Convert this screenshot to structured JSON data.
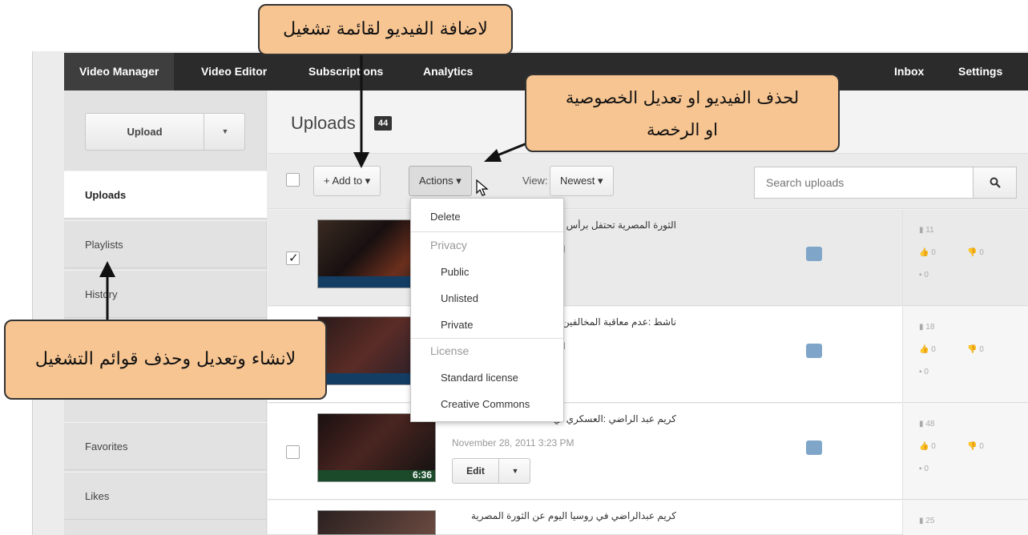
{
  "topbar": {
    "items": [
      "Video Manager",
      "Video Editor",
      "Subscriptions",
      "Analytics",
      "Inbox",
      "Settings"
    ]
  },
  "sidebar": {
    "upload_label": "Upload",
    "items": [
      "Uploads",
      "Playlists",
      "History",
      "Favorites",
      "Likes"
    ]
  },
  "main": {
    "title": "Uploads",
    "count": "44",
    "toolbar": {
      "add_to": "+ Add to ▾",
      "actions": "Actions ▾",
      "view_label": "View:",
      "view_value": "Newest ▾",
      "search_placeholder": "Search uploads"
    }
  },
  "actions_menu": {
    "delete": "Delete",
    "privacy_header": "Privacy",
    "privacy": [
      "Public",
      "Unlisted",
      "Private"
    ],
    "license_header": "License",
    "license": [
      "Standard license",
      "Creative Commons"
    ]
  },
  "videos": [
    {
      "title": "الثورة المصرية تحتفل برأس",
      "date_fragment": "M",
      "views": "11",
      "likes": "0",
      "dislikes": "0",
      "comments": "0",
      "checked": true
    },
    {
      "title": "ناشط :عدم معاقبة المخالفين يو",
      "date_fragment": "M",
      "views": "18",
      "likes": "0",
      "dislikes": "0",
      "comments": "0",
      "checked": false
    },
    {
      "title": "كريم عبد الراضي :العسكري أي",
      "date": "November 28, 2011 3:23 PM",
      "duration": "6:36",
      "edit_label": "Edit",
      "views": "48",
      "likes": "0",
      "dislikes": "0",
      "comments": "0",
      "checked": false
    },
    {
      "title": "كريم عبدالراضي في روسيا اليوم عن الثورة المصرية",
      "views": "25"
    }
  ],
  "callouts": {
    "add_to_playlist": "لاضافة الفيديو لقائمة تشغيل",
    "delete_privacy_line1": "لحذف الفيديو او تعديل الخصوصية",
    "delete_privacy_line2": "او الرخصة",
    "playlists": "لانشاء وتعديل وحذف قوائم التشغيل"
  }
}
